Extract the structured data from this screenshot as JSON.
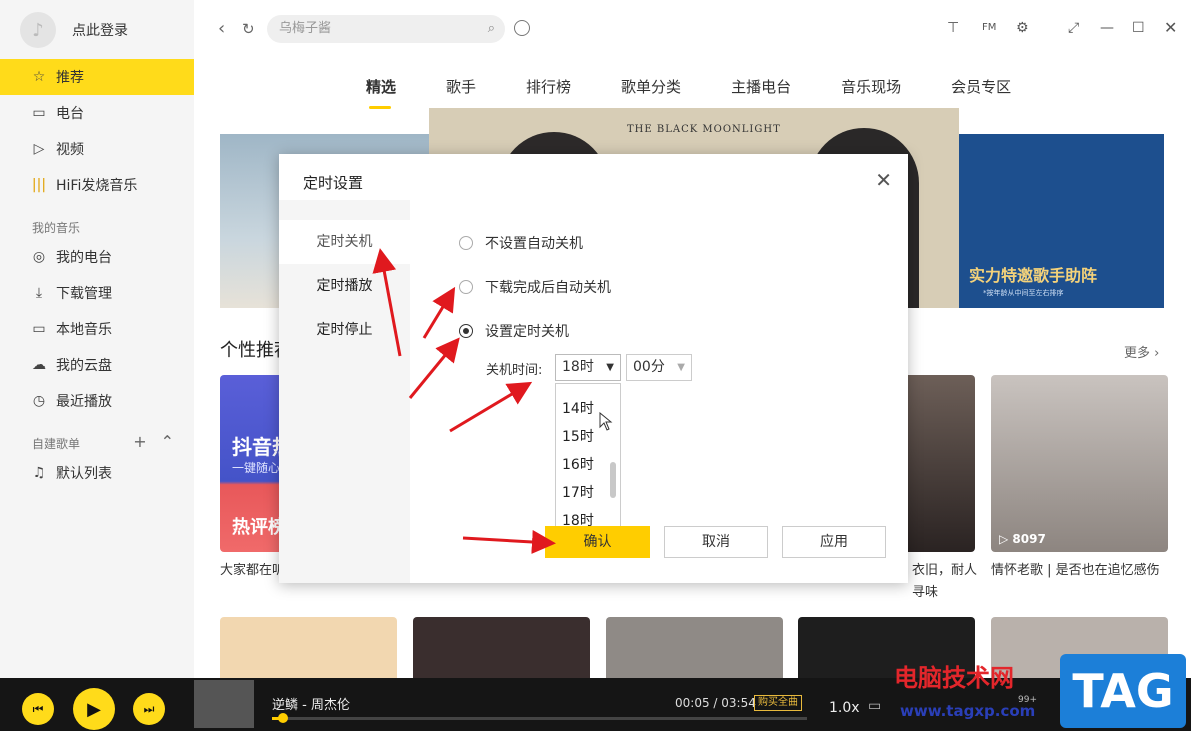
{
  "sidebar": {
    "login_label": "点此登录",
    "nav": [
      {
        "label": "推荐",
        "icon": "star-icon"
      },
      {
        "label": "电台",
        "icon": "radio-icon"
      },
      {
        "label": "视频",
        "icon": "video-icon"
      },
      {
        "label": "HiFi发烧音乐",
        "icon": "hifi-icon"
      }
    ],
    "my_music_label": "我的音乐",
    "my_music": [
      {
        "label": "我的电台",
        "icon": "podcast-icon"
      },
      {
        "label": "下载管理",
        "icon": "download-icon"
      },
      {
        "label": "本地音乐",
        "icon": "monitor-icon"
      },
      {
        "label": "我的云盘",
        "icon": "cloud-icon"
      },
      {
        "label": "最近播放",
        "icon": "clock-icon"
      }
    ],
    "playlist_label": "自建歌单",
    "playlists": [
      {
        "label": "默认列表",
        "icon": "playlist-icon"
      }
    ]
  },
  "topbar": {
    "search_text": "乌梅子酱"
  },
  "tabs": [
    "精选",
    "歌手",
    "排行榜",
    "歌单分类",
    "主播电台",
    "音乐现场",
    "会员专区"
  ],
  "banner": {
    "center_title": "THE BLACK MOONLIGHT",
    "right_title": "实力特邀歌手助阵",
    "right_sub": "*按年龄从中间至左右排序"
  },
  "recommend": {
    "title": "个性推荐",
    "more": "更多",
    "cards": [
      {
        "overlay": "抖音热",
        "overlay_sub": "一键随心",
        "overlay2": "热评榜",
        "caption": "大家都在听"
      },
      {
        "caption": "衣旧，耐人寻味"
      },
      {
        "play_count": "8097",
        "caption": "情怀老歌 | 是否也在追忆感伤"
      }
    ]
  },
  "dialog": {
    "title": "定时设置",
    "side_items": [
      "定时关机",
      "定时播放",
      "定时停止"
    ],
    "options": [
      "不设置自动关机",
      "下载完成后自动关机",
      "设置定时关机"
    ],
    "selected_option": 2,
    "shutdown_label": "关机时间:",
    "hour_value": "18时",
    "minute_value": "00分",
    "hour_options": [
      "14时",
      "15时",
      "16时",
      "17时",
      "18时"
    ],
    "confirm": "确认",
    "cancel": "取消",
    "apply": "应用"
  },
  "player": {
    "song": "逆鳞 - 周杰伦",
    "current_time": "00:05",
    "total_time": "03:54",
    "buy_label": "购买全曲",
    "speed": "1.0x",
    "quality_badge": "99+",
    "progress_fraction": 0.02
  },
  "watermark": {
    "cn": "电脑技术网",
    "url": "www.tagxp.com",
    "tag": "TAG"
  },
  "colors": {
    "accent": "#ffdb1a",
    "arrow": "#e0191e"
  }
}
